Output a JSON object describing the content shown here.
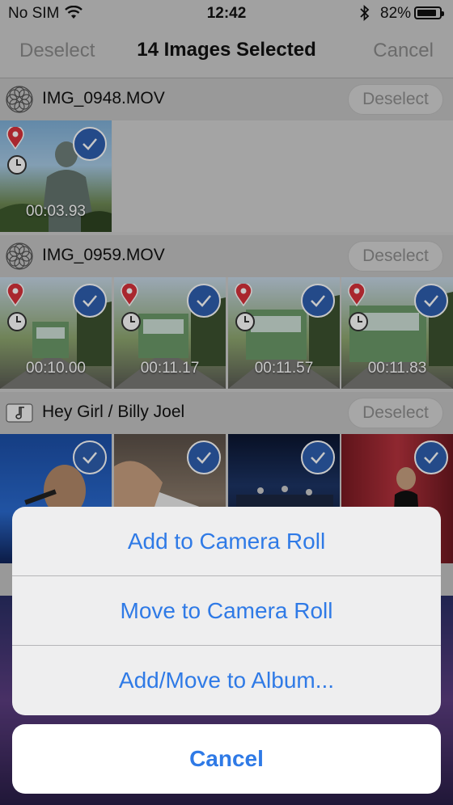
{
  "status_bar": {
    "carrier": "No SIM",
    "time": "12:42",
    "battery_percent": "82%",
    "battery_level": 0.82
  },
  "nav": {
    "left": "Deselect",
    "title": "14 Images Selected",
    "right": "Cancel"
  },
  "sections": [
    {
      "title": "IMG_0948.MOV",
      "button": "Deselect",
      "icon": "flower-icon",
      "thumbs": [
        {
          "duration": "00:03.93",
          "subject": "buddha-statue"
        }
      ]
    },
    {
      "title": "IMG_0959.MOV",
      "button": "Deselect",
      "icon": "flower-icon",
      "thumbs": [
        {
          "duration": "00:10.00"
        },
        {
          "duration": "00:11.17"
        },
        {
          "duration": "00:11.57"
        },
        {
          "duration": "00:11.83"
        }
      ]
    },
    {
      "title": "Hey Girl / Billy Joel",
      "button": "Deselect",
      "icon": "music-note-icon",
      "thumbs": [
        {},
        {},
        {},
        {}
      ]
    }
  ],
  "action_sheet": {
    "actions": [
      "Add to Camera Roll",
      "Move to Camera Roll",
      "Add/Move to Album..."
    ],
    "cancel": "Cancel",
    "accent_color": "#2f7ae6"
  }
}
